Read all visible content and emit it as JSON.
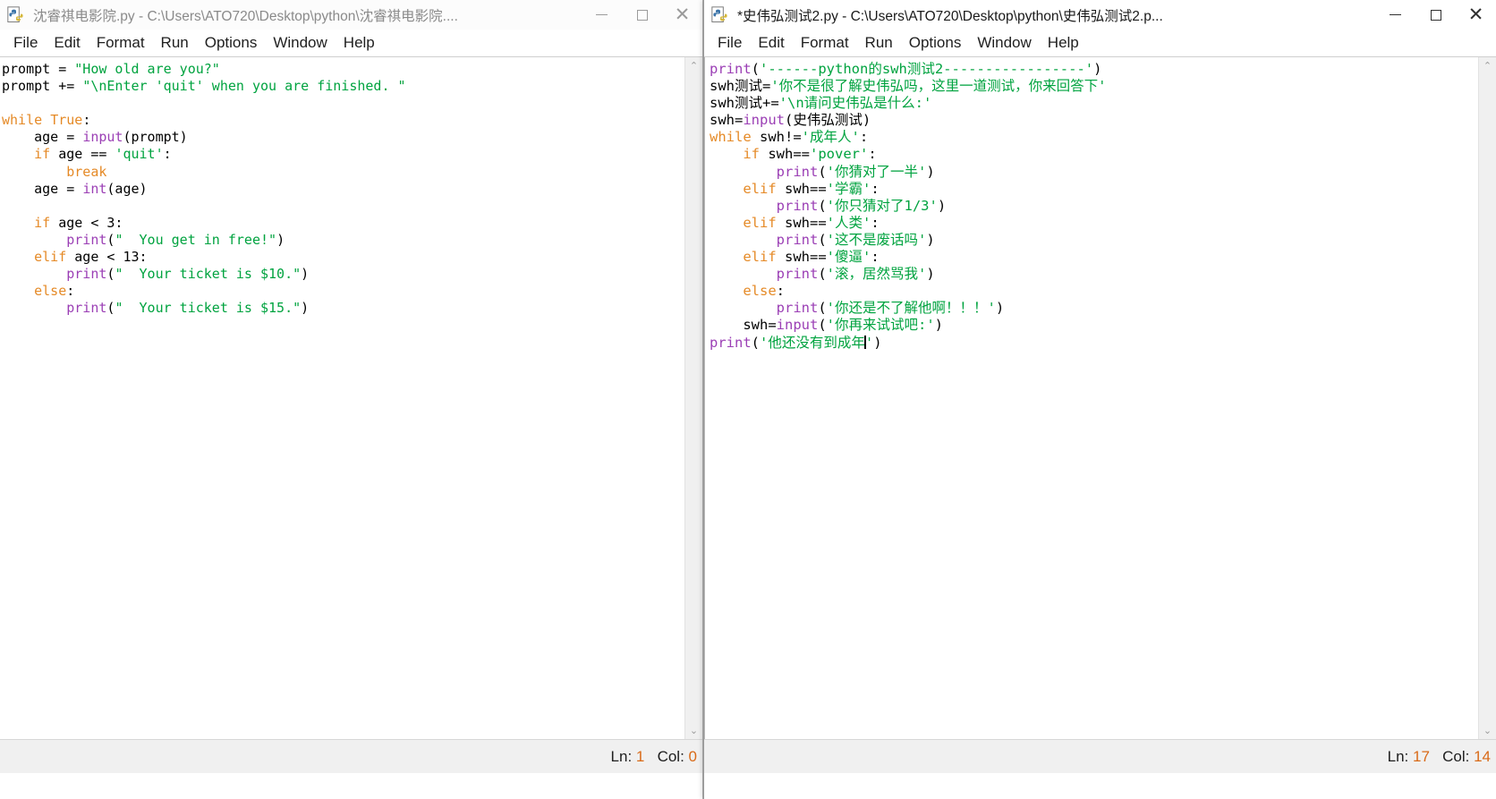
{
  "windows": {
    "left": {
      "title": "沈睿祺电影院.py - C:\\Users\\ATO720\\Desktop\\python\\沈睿祺电影院....",
      "icon_name": "python-idle-icon",
      "menu": [
        "File",
        "Edit",
        "Format",
        "Run",
        "Options",
        "Window",
        "Help"
      ],
      "caption": {
        "minimize": "–",
        "maximize": "□",
        "close": "✕"
      },
      "status": "Ln: 1  Col: 0",
      "status_ln_label": "Ln:",
      "status_ln_value": "1",
      "status_col_label": "Col:",
      "status_col_value": "0",
      "scrollbar": {
        "up": "⌃",
        "down": "⌄"
      },
      "code_lines": [
        [
          {
            "t": "prompt = ",
            "c": "d"
          },
          {
            "t": "\"How old are you?\"",
            "c": "s"
          }
        ],
        [
          {
            "t": "prompt += ",
            "c": "d"
          },
          {
            "t": "\"\\nEnter 'quit' when you are finished. \"",
            "c": "s"
          }
        ],
        [],
        [
          {
            "t": "while",
            "c": "k"
          },
          {
            "t": " ",
            "c": "d"
          },
          {
            "t": "True",
            "c": "k"
          },
          {
            "t": ":",
            "c": "d"
          }
        ],
        [
          {
            "t": "    age = ",
            "c": "d"
          },
          {
            "t": "input",
            "c": "b"
          },
          {
            "t": "(prompt)",
            "c": "d"
          }
        ],
        [
          {
            "t": "    ",
            "c": "d"
          },
          {
            "t": "if",
            "c": "k"
          },
          {
            "t": " age == ",
            "c": "d"
          },
          {
            "t": "'quit'",
            "c": "s"
          },
          {
            "t": ":",
            "c": "d"
          }
        ],
        [
          {
            "t": "        ",
            "c": "d"
          },
          {
            "t": "break",
            "c": "k"
          }
        ],
        [
          {
            "t": "    age = ",
            "c": "d"
          },
          {
            "t": "int",
            "c": "b"
          },
          {
            "t": "(age)",
            "c": "d"
          }
        ],
        [],
        [
          {
            "t": "    ",
            "c": "d"
          },
          {
            "t": "if",
            "c": "k"
          },
          {
            "t": " age < 3:",
            "c": "d"
          }
        ],
        [
          {
            "t": "        ",
            "c": "d"
          },
          {
            "t": "print",
            "c": "b"
          },
          {
            "t": "(",
            "c": "d"
          },
          {
            "t": "\"  You get in free!\"",
            "c": "s"
          },
          {
            "t": ")",
            "c": "d"
          }
        ],
        [
          {
            "t": "    ",
            "c": "d"
          },
          {
            "t": "elif",
            "c": "k"
          },
          {
            "t": " age < 13:",
            "c": "d"
          }
        ],
        [
          {
            "t": "        ",
            "c": "d"
          },
          {
            "t": "print",
            "c": "b"
          },
          {
            "t": "(",
            "c": "d"
          },
          {
            "t": "\"  Your ticket is $10.\"",
            "c": "s"
          },
          {
            "t": ")",
            "c": "d"
          }
        ],
        [
          {
            "t": "    ",
            "c": "d"
          },
          {
            "t": "else",
            "c": "k"
          },
          {
            "t": ":",
            "c": "d"
          }
        ],
        [
          {
            "t": "        ",
            "c": "d"
          },
          {
            "t": "print",
            "c": "b"
          },
          {
            "t": "(",
            "c": "d"
          },
          {
            "t": "\"  Your ticket is $15.\"",
            "c": "s"
          },
          {
            "t": ")",
            "c": "d"
          }
        ]
      ]
    },
    "right": {
      "title": "*史伟弘测试2.py - C:\\Users\\ATO720\\Desktop\\python\\史伟弘测试2.p...",
      "icon_name": "python-idle-icon",
      "menu": [
        "File",
        "Edit",
        "Format",
        "Run",
        "Options",
        "Window",
        "Help"
      ],
      "caption": {
        "minimize": "–",
        "maximize": "□",
        "close": "✕"
      },
      "status": "Ln: 17  Col: 14",
      "status_ln_label": "Ln:",
      "status_ln_value": "17",
      "status_col_label": "Col:",
      "status_col_value": "14",
      "scrollbar": {
        "up": "⌃",
        "down": "⌄"
      },
      "code_lines": [
        [
          {
            "t": "print",
            "c": "b"
          },
          {
            "t": "(",
            "c": "d"
          },
          {
            "t": "'------python的swh测试2-----------------'",
            "c": "s"
          },
          {
            "t": ")",
            "c": "d"
          }
        ],
        [
          {
            "t": "swh测试=",
            "c": "d"
          },
          {
            "t": "'你不是很了解史伟弘吗，这里一道测试，你来回答下'",
            "c": "s"
          }
        ],
        [
          {
            "t": "swh测试+=",
            "c": "d"
          },
          {
            "t": "'\\n请问史伟弘是什么:'",
            "c": "s"
          }
        ],
        [
          {
            "t": "swh=",
            "c": "d"
          },
          {
            "t": "input",
            "c": "b"
          },
          {
            "t": "(史伟弘测试)",
            "c": "d"
          }
        ],
        [
          {
            "t": "while",
            "c": "k"
          },
          {
            "t": " swh!=",
            "c": "d"
          },
          {
            "t": "'成年人'",
            "c": "s"
          },
          {
            "t": ":",
            "c": "d"
          }
        ],
        [
          {
            "t": "    ",
            "c": "d"
          },
          {
            "t": "if",
            "c": "k"
          },
          {
            "t": " swh==",
            "c": "d"
          },
          {
            "t": "'pover'",
            "c": "s"
          },
          {
            "t": ":",
            "c": "d"
          }
        ],
        [
          {
            "t": "        ",
            "c": "d"
          },
          {
            "t": "print",
            "c": "b"
          },
          {
            "t": "(",
            "c": "d"
          },
          {
            "t": "'你猜对了一半'",
            "c": "s"
          },
          {
            "t": ")",
            "c": "d"
          }
        ],
        [
          {
            "t": "    ",
            "c": "d"
          },
          {
            "t": "elif",
            "c": "k"
          },
          {
            "t": " swh==",
            "c": "d"
          },
          {
            "t": "'学霸'",
            "c": "s"
          },
          {
            "t": ":",
            "c": "d"
          }
        ],
        [
          {
            "t": "        ",
            "c": "d"
          },
          {
            "t": "print",
            "c": "b"
          },
          {
            "t": "(",
            "c": "d"
          },
          {
            "t": "'你只猜对了1/3'",
            "c": "s"
          },
          {
            "t": ")",
            "c": "d"
          }
        ],
        [
          {
            "t": "    ",
            "c": "d"
          },
          {
            "t": "elif",
            "c": "k"
          },
          {
            "t": " swh==",
            "c": "d"
          },
          {
            "t": "'人类'",
            "c": "s"
          },
          {
            "t": ":",
            "c": "d"
          }
        ],
        [
          {
            "t": "        ",
            "c": "d"
          },
          {
            "t": "print",
            "c": "b"
          },
          {
            "t": "(",
            "c": "d"
          },
          {
            "t": "'这不是废话吗'",
            "c": "s"
          },
          {
            "t": ")",
            "c": "d"
          }
        ],
        [
          {
            "t": "    ",
            "c": "d"
          },
          {
            "t": "elif",
            "c": "k"
          },
          {
            "t": " swh==",
            "c": "d"
          },
          {
            "t": "'傻逼'",
            "c": "s"
          },
          {
            "t": ":",
            "c": "d"
          }
        ],
        [
          {
            "t": "        ",
            "c": "d"
          },
          {
            "t": "print",
            "c": "b"
          },
          {
            "t": "(",
            "c": "d"
          },
          {
            "t": "'滚，居然骂我'",
            "c": "s"
          },
          {
            "t": ")",
            "c": "d"
          }
        ],
        [
          {
            "t": "    ",
            "c": "d"
          },
          {
            "t": "else",
            "c": "k"
          },
          {
            "t": ":",
            "c": "d"
          }
        ],
        [
          {
            "t": "        ",
            "c": "d"
          },
          {
            "t": "print",
            "c": "b"
          },
          {
            "t": "(",
            "c": "d"
          },
          {
            "t": "'你还是不了解他啊！！！'",
            "c": "s"
          },
          {
            "t": ")",
            "c": "d"
          }
        ],
        [
          {
            "t": "    swh=",
            "c": "d"
          },
          {
            "t": "input",
            "c": "b"
          },
          {
            "t": "(",
            "c": "d"
          },
          {
            "t": "'你再来试试吧:'",
            "c": "s"
          },
          {
            "t": ")",
            "c": "d"
          }
        ],
        [
          {
            "t": "print",
            "c": "b"
          },
          {
            "t": "(",
            "c": "d"
          },
          {
            "t": "'他还没有到成年",
            "c": "s"
          },
          {
            "t": "|CURSOR|",
            "c": "cursor"
          },
          {
            "t": "'",
            "c": "s"
          },
          {
            "t": ")",
            "c": "d"
          }
        ]
      ]
    }
  },
  "colors": {
    "keyword": "#e58a27",
    "string": "#00a33f",
    "builtin": "#9b3fb5",
    "default": "#000000",
    "status_accent": "#d96a18",
    "chrome": "#f0f0f0"
  }
}
